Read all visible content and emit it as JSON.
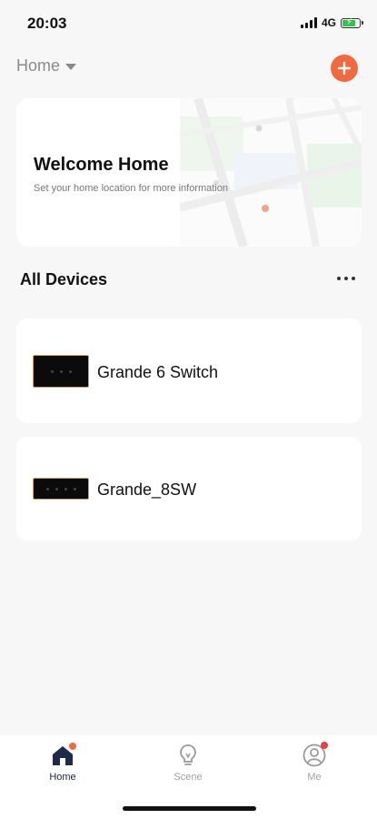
{
  "status": {
    "time": "20:03",
    "network": "4G"
  },
  "header": {
    "home_label": "Home",
    "add_icon": "plus-icon",
    "accent_color": "#f06a3d"
  },
  "welcome": {
    "title": "Welcome Home",
    "subtitle": "Set your home location for more information"
  },
  "devices_section": {
    "title": "All Devices",
    "more_icon": "more-icon"
  },
  "devices": [
    {
      "name": "Grande 6 Switch",
      "icon": "switch-panel-icon"
    },
    {
      "name": "Grande_8SW",
      "icon": "switch-panel-icon"
    }
  ],
  "tabs": [
    {
      "label": "Home",
      "icon": "home-icon",
      "active": true
    },
    {
      "label": "Scene",
      "icon": "lightbulb-icon",
      "active": false
    },
    {
      "label": "Me",
      "icon": "profile-icon",
      "active": false
    }
  ]
}
